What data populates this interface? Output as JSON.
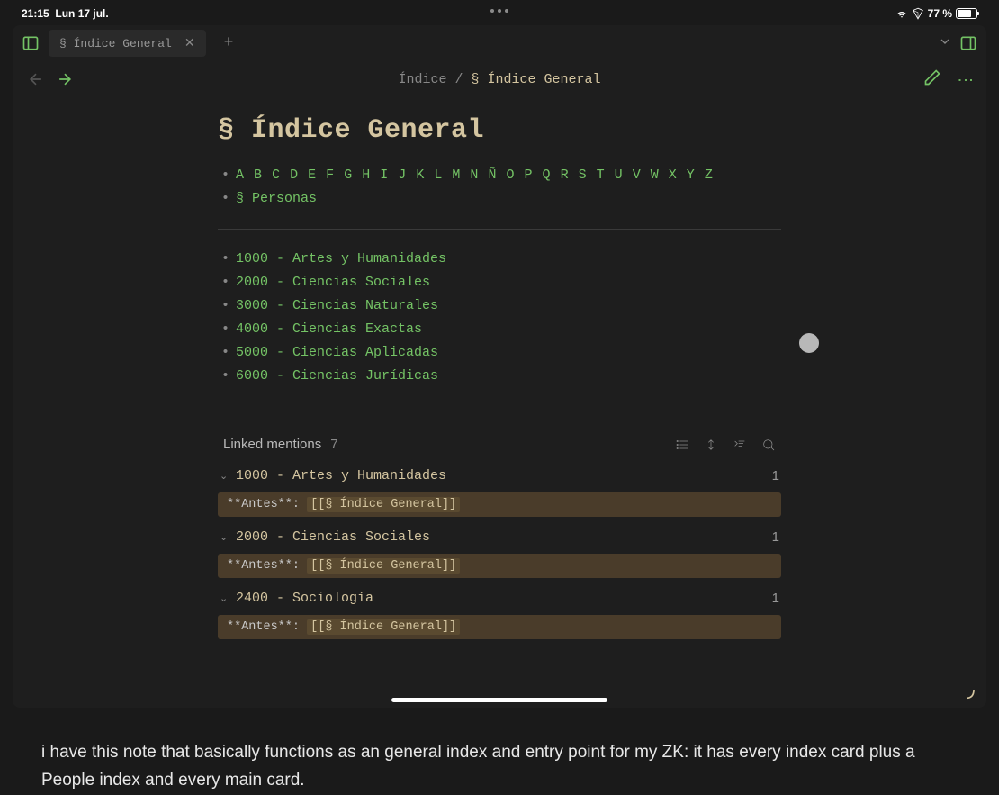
{
  "status": {
    "time": "21:15",
    "date": "Lun 17 jul.",
    "battery_pct": "77 %"
  },
  "tab": {
    "title": "§ Índice General"
  },
  "breadcrumb": {
    "parent": "Índice",
    "sep": " / ",
    "current": "§ Índice General"
  },
  "page": {
    "title": "§ Índice General",
    "alpha": [
      "A",
      "B",
      "C",
      "D",
      "E",
      "F",
      "G",
      "H",
      "I",
      "J",
      "K",
      "L",
      "M",
      "N",
      "Ñ",
      "O",
      "P",
      "Q",
      "R",
      "S",
      "T",
      "U",
      "V",
      "W",
      "X",
      "Y",
      "Z"
    ],
    "personas": "§ Personas",
    "categories": [
      "1000 - Artes y Humanidades",
      "2000 - Ciencias Sociales",
      "3000 - Ciencias Naturales",
      "4000 - Ciencias Exactas",
      "5000 - Ciencias Aplicadas",
      "6000 - Ciencias Jurídicas"
    ]
  },
  "linked": {
    "label": "Linked mentions",
    "count": "7",
    "groups": [
      {
        "title": "1000 - Artes y Humanidades",
        "count": "1",
        "prefix": "**Antes**: ",
        "link": "[[§ Índice General]]"
      },
      {
        "title": "2000 - Ciencias Sociales",
        "count": "1",
        "prefix": "**Antes**: ",
        "link": "[[§ Índice General]]"
      },
      {
        "title": "2400 - Sociología",
        "count": "1",
        "prefix": "**Antes**: ",
        "link": "[[§ Índice General]]"
      }
    ]
  },
  "caption": "i have this note that basically functions as an general index and entry point for my ZK: it has every index card plus a People index and every main card."
}
